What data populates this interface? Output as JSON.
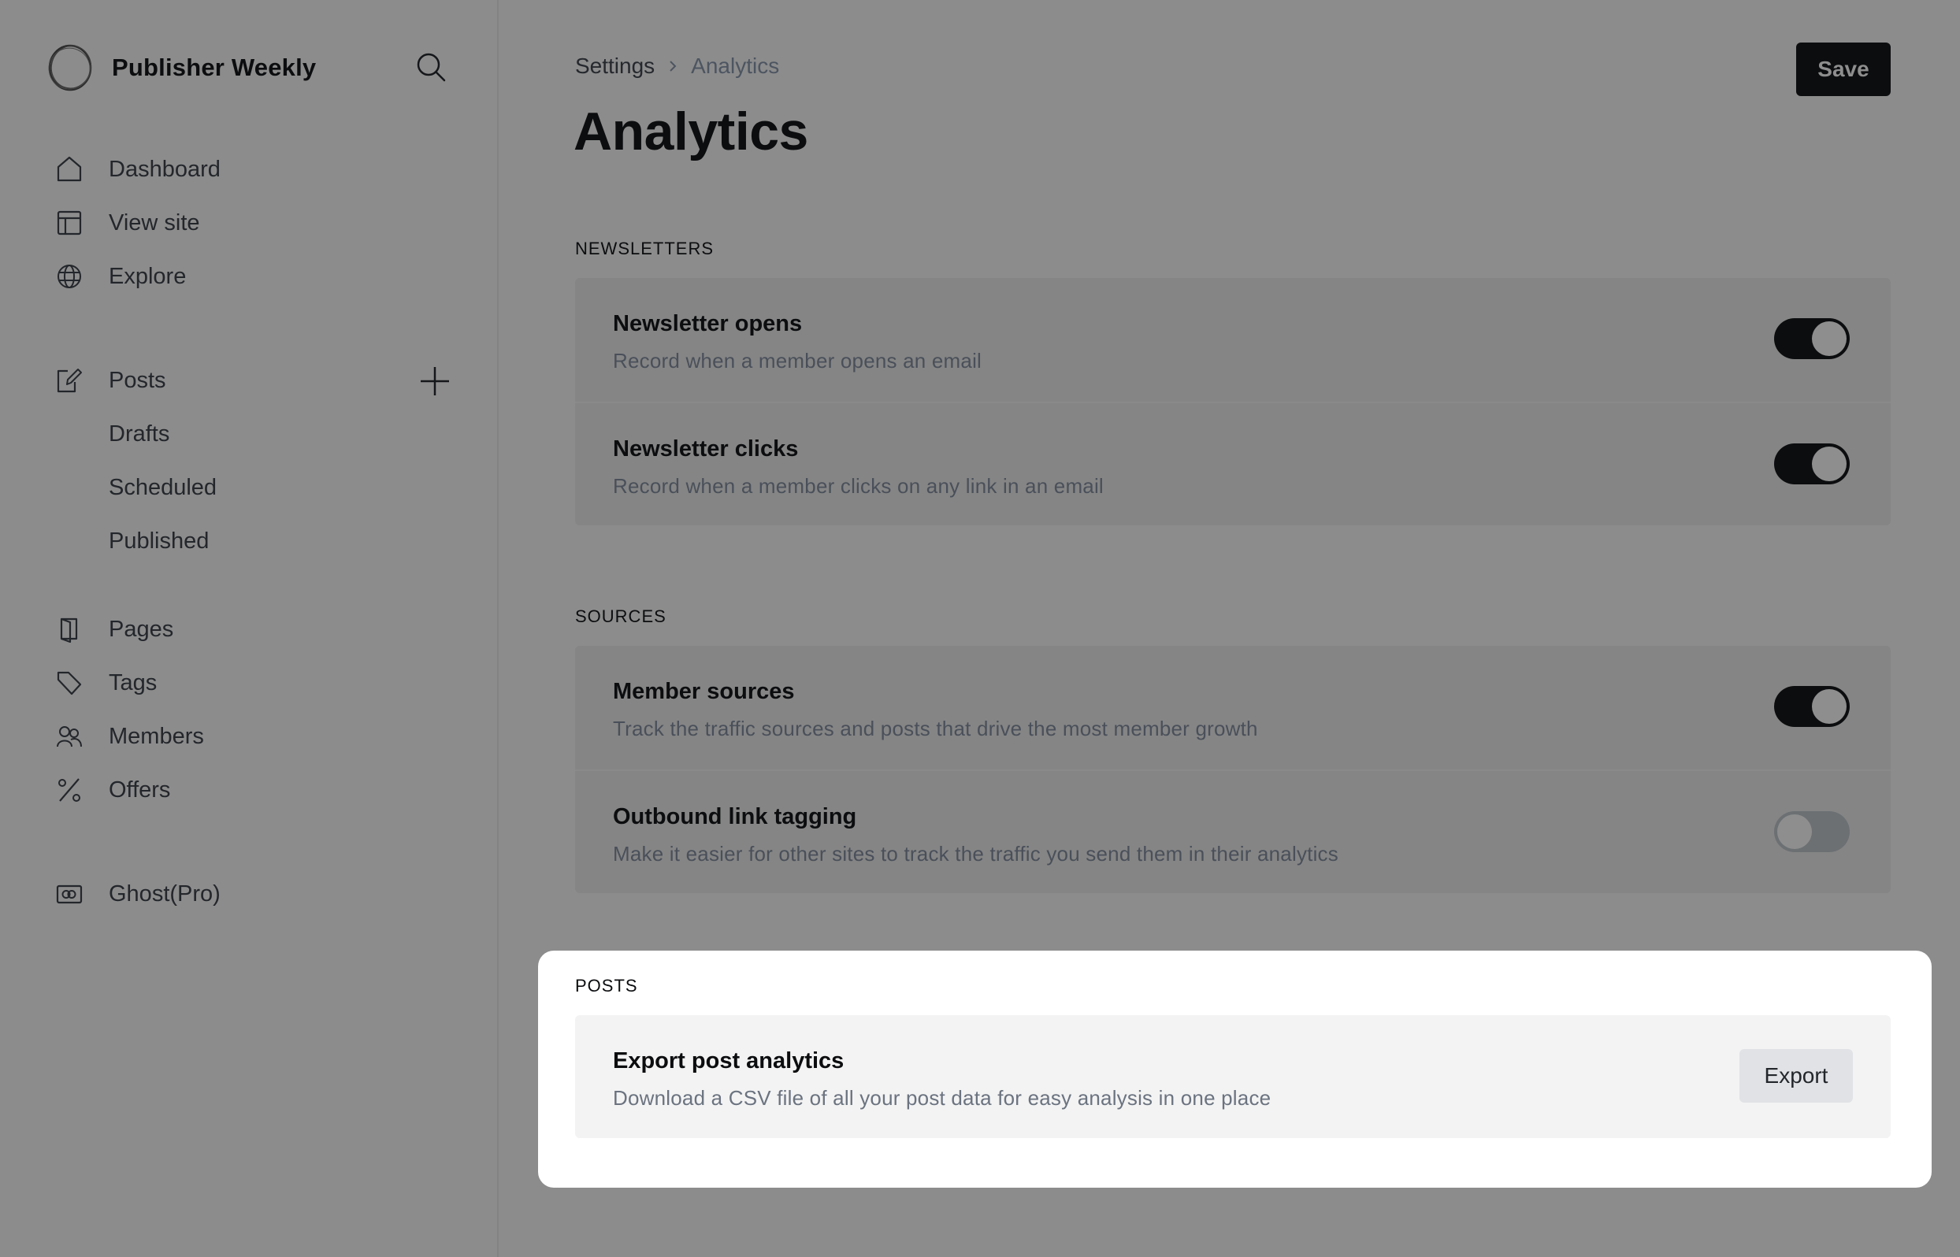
{
  "sidebar": {
    "brand": {
      "name": "Publisher Weekly",
      "logo_icon": "ghost-logo-icon"
    },
    "search_icon": "search-icon",
    "items": [
      {
        "label": "Dashboard",
        "icon": "home-icon"
      },
      {
        "label": "View site",
        "icon": "layout-icon"
      },
      {
        "label": "Explore",
        "icon": "globe-icon"
      },
      {
        "label": "Posts",
        "icon": "pen-square-icon"
      },
      {
        "label": "Drafts"
      },
      {
        "label": "Scheduled"
      },
      {
        "label": "Published"
      },
      {
        "label": "Pages",
        "icon": "page-icon"
      },
      {
        "label": "Tags",
        "icon": "tag-icon"
      },
      {
        "label": "Members",
        "icon": "members-icon"
      },
      {
        "label": "Offers",
        "icon": "percent-icon"
      },
      {
        "label": "Ghost(Pro)",
        "icon": "ghost-pro-icon"
      }
    ],
    "add_post_icon": "plus-icon"
  },
  "header": {
    "breadcrumb": {
      "parent": "Settings",
      "current": "Analytics"
    },
    "title": "Analytics",
    "save_label": "Save"
  },
  "sections": {
    "newsletters": {
      "label": "NEWSLETTERS",
      "rows": [
        {
          "title": "Newsletter opens",
          "desc": "Record when a member opens an email",
          "enabled": true
        },
        {
          "title": "Newsletter clicks",
          "desc": "Record when a member clicks on any link in an email",
          "enabled": true
        }
      ]
    },
    "sources": {
      "label": "SOURCES",
      "rows": [
        {
          "title": "Member sources",
          "desc": "Track the traffic sources and posts that drive the most member growth",
          "enabled": true
        },
        {
          "title": "Outbound link tagging",
          "desc": "Make it easier for other sites to track the traffic you send them in their analytics",
          "enabled": false
        }
      ]
    },
    "posts": {
      "label": "POSTS",
      "row": {
        "title": "Export post analytics",
        "desc": "Download a CSV file of all your post data for easy analysis in one place",
        "button": "Export"
      }
    }
  },
  "colors": {
    "overlay_bg": "#8c8c8c",
    "toggle_on": "#0c0d0f",
    "toggle_off": "#6c7073",
    "highlight_bg": "#ffffff"
  }
}
